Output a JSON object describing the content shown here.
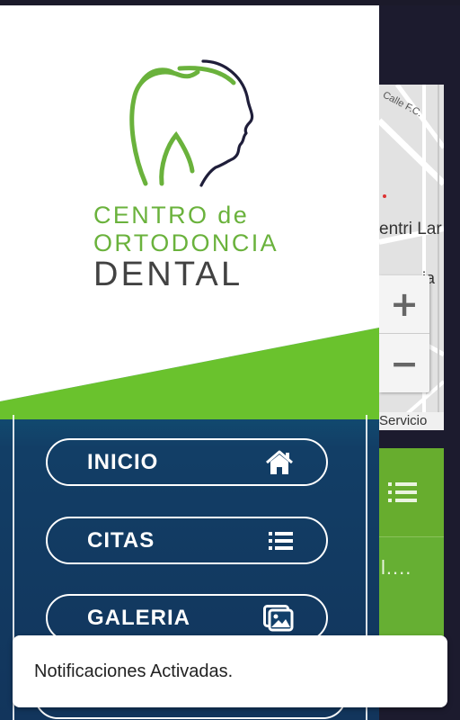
{
  "app": {
    "brand": {
      "line1": "CENTRO de",
      "line2": "ORTODONCIA",
      "line3": "DENTAL",
      "primary_color": "#6ab23c",
      "dark_color": "#424242"
    },
    "menu": {
      "items": [
        {
          "label": "INICIO",
          "icon": "home-icon"
        },
        {
          "label": "CITAS",
          "icon": "list-icon"
        },
        {
          "label": "GALERIA",
          "icon": "gallery-icon"
        }
      ]
    },
    "background": {
      "map_street": "Calle F.C.",
      "map_place": "entri Lar",
      "map_place2": "ia",
      "zoom_in": "+",
      "zoom_out": "−",
      "map_footer": "Servicio",
      "card_text": "l....",
      "accent_color": "#66af33"
    },
    "toast": {
      "message": "Notificaciones Activadas."
    }
  }
}
